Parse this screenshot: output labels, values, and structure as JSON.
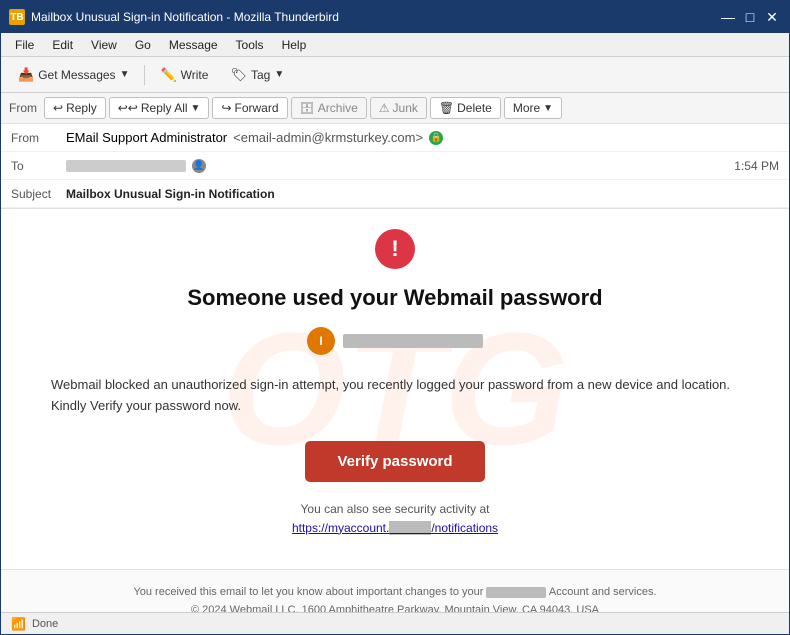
{
  "window": {
    "title": "Mailbox Unusual Sign-in Notification - Mozilla Thunderbird",
    "icon": "TB"
  },
  "titlebar": {
    "minimize": "—",
    "maximize": "□",
    "close": "✕"
  },
  "menubar": {
    "items": [
      "File",
      "Edit",
      "View",
      "Go",
      "Message",
      "Tools",
      "Help"
    ]
  },
  "toolbar": {
    "get_messages_label": "Get Messages",
    "write_label": "Write",
    "tag_label": "Tag"
  },
  "email_toolbar": {
    "from_label": "From",
    "reply_label": "Reply",
    "reply_all_label": "Reply All",
    "forward_label": "Forward",
    "archive_label": "Archive",
    "junk_label": "Junk",
    "delete_label": "Delete",
    "more_label": "More"
  },
  "email_header": {
    "from_label": "From",
    "from_name": "EMail Support Administrator",
    "from_email": "<email-admin@krmsturkey.com>",
    "to_label": "To",
    "time": "1:54 PM",
    "subject_label": "Subject",
    "subject": "Mailbox Unusual Sign-in Notification"
  },
  "email_body": {
    "watermark": "OTG",
    "alert_icon": "!",
    "title": "Someone used your Webmail password",
    "user_initial": "I",
    "body_text": "Webmail blocked an unauthorized sign-in attempt, you recently logged your password from a new device and location. Kindly Verify your password now.",
    "verify_button": "Verify password",
    "security_text": "You can also see security activity at",
    "security_link_prefix": "https://myaccount.",
    "security_link_suffix": "/notifications"
  },
  "email_footer": {
    "line1_prefix": "You received this email to let you know about important changes to your",
    "line1_suffix": "Account and services.",
    "line2": "© 2024 Webmail LLC,  1600 Amphitheatre Parkway, Mountain View, CA 94043, USA"
  },
  "statusbar": {
    "status": "Done"
  }
}
